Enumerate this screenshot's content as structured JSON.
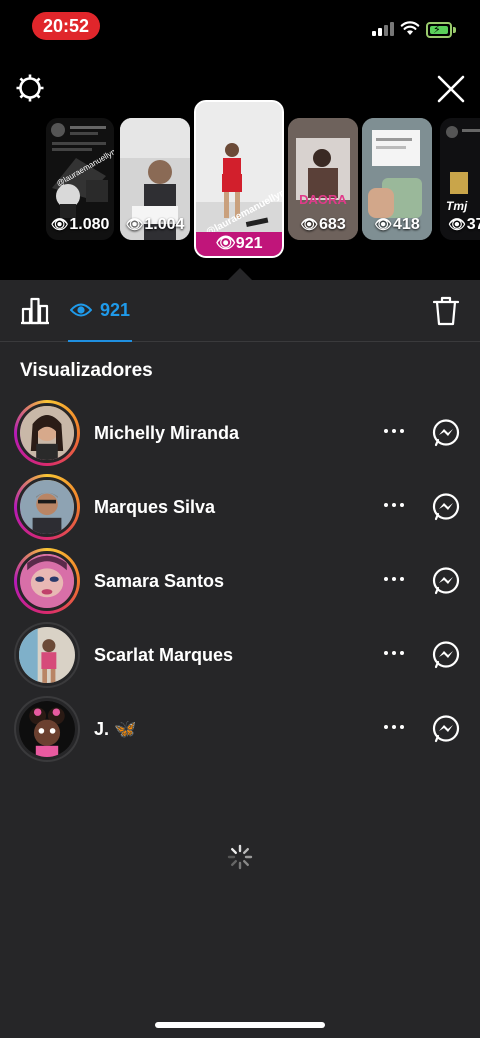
{
  "status_bar": {
    "time": "20:52",
    "time_pill_color": "#e0262b"
  },
  "header": {
    "settings_icon": "gear-icon",
    "close_icon": "close-icon"
  },
  "stories": [
    {
      "label": "story-1",
      "views": "1.080"
    },
    {
      "label": "story-2",
      "views": "1.004"
    },
    {
      "label": "story-3",
      "views": "921",
      "active": true,
      "caption": "@lauraemanuellym"
    },
    {
      "label": "story-4",
      "views": "683",
      "caption": "DAORA"
    },
    {
      "label": "story-5",
      "views": "418"
    },
    {
      "label": "story-6",
      "views": "37"
    }
  ],
  "toolbar": {
    "views_count": "921",
    "accent": "#1f9aea"
  },
  "section_title": "Visualizadores",
  "viewers": [
    {
      "name": "Michelly Miranda"
    },
    {
      "name": "Marques Silva"
    },
    {
      "name": "Samara Santos"
    },
    {
      "name": "Scarlat Marques"
    },
    {
      "name": "J. 🦋"
    }
  ]
}
